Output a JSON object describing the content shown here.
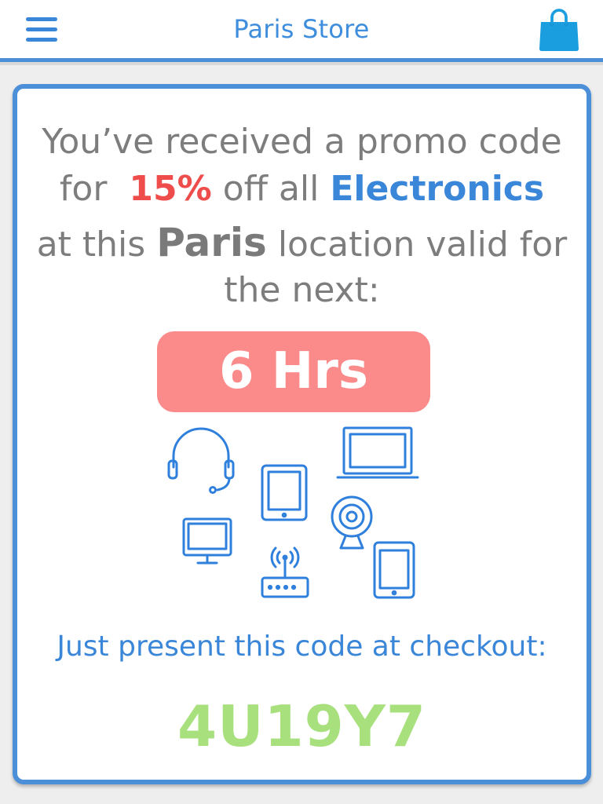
{
  "header": {
    "title": "Paris Store",
    "menu_icon": "hamburger-menu-icon",
    "cart_icon": "shopping-bag-icon"
  },
  "promo": {
    "line1": "You’ve received a promo code",
    "for_word": "for",
    "discount": "15%",
    "off_all": "off all",
    "category": "Electronics",
    "at_this": "at this",
    "location": "Paris",
    "valid_for": "location valid for",
    "the_next": "the next:"
  },
  "timer": {
    "label": "6 Hrs"
  },
  "devices": {
    "icons": [
      "headset-icon",
      "tablet-icon",
      "laptop-icon",
      "monitor-icon",
      "webcam-icon",
      "router-icon",
      "smartphone-icon"
    ]
  },
  "checkout": {
    "instruction": "Just present this code at checkout:",
    "code": "4U19Y7"
  },
  "colors": {
    "brand_blue": "#3a86d8",
    "discount_red": "#ef4c4c",
    "timer_bg": "#fb8a8a",
    "code_green": "#a7e07c",
    "body_text_gray": "#7d7d7d"
  }
}
